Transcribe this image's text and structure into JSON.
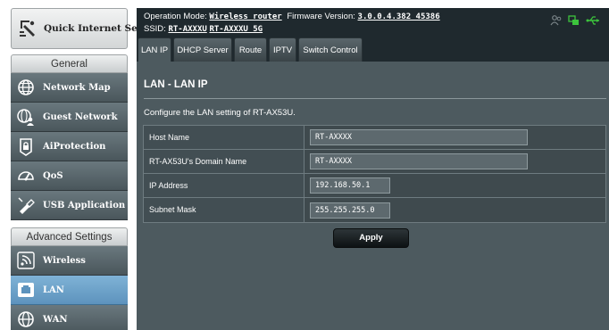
{
  "sidebar": {
    "quick_setup": {
      "label": "Quick Internet Setup",
      "icon": "wizard-icon"
    },
    "general_heading": "General",
    "general_items": [
      {
        "label": "Network Map",
        "icon": "globe-icon"
      },
      {
        "label": "Guest Network",
        "icon": "guest-network-icon"
      },
      {
        "label": "AiProtection",
        "icon": "lock-icon"
      },
      {
        "label": "QoS",
        "icon": "speedometer-icon"
      },
      {
        "label": "USB Application",
        "icon": "usb-icon"
      }
    ],
    "advanced_heading": "Advanced Settings",
    "advanced_items": [
      {
        "label": "Wireless",
        "icon": "wifi-icon"
      },
      {
        "label": "LAN",
        "icon": "lan-icon",
        "active": true
      },
      {
        "label": "WAN",
        "icon": "globe-icon"
      }
    ]
  },
  "header": {
    "mode_label": "Operation Mode:",
    "mode_value": "Wireless router",
    "firmware_label": "Firmware Version:",
    "firmware_value": "3.0.0.4.382_45386",
    "ssid_label": "SSID:",
    "ssid_1": "RT-AXXXU",
    "ssid_2": "RT-AXXXU_5G",
    "status_icons": [
      "clients-icon",
      "network-status-icon",
      "usb-status-icon"
    ]
  },
  "tabs": [
    {
      "label": "LAN IP",
      "active": true
    },
    {
      "label": "DHCP Server"
    },
    {
      "label": "Route"
    },
    {
      "label": "IPTV"
    },
    {
      "label": "Switch Control"
    }
  ],
  "main": {
    "title": "LAN - LAN IP",
    "description": "Configure the LAN setting of RT-AX53U.",
    "fields": [
      {
        "label": "Host Name",
        "value": "RT-AXXXX"
      },
      {
        "label": "RT-AX53U's Domain Name",
        "value": "RT-AXXXX"
      },
      {
        "label": "IP Address",
        "value": "192.168.50.1"
      },
      {
        "label": "Subnet Mask",
        "value": "255.255.255.0"
      }
    ],
    "apply_label": "Apply"
  },
  "colors": {
    "sidebar_dark": "#4a565b",
    "sidebar_active": "#6aa0c8",
    "header_bg": "#1f292e",
    "content_bg": "#4d5a5f",
    "status_green": "#3cc43c"
  }
}
